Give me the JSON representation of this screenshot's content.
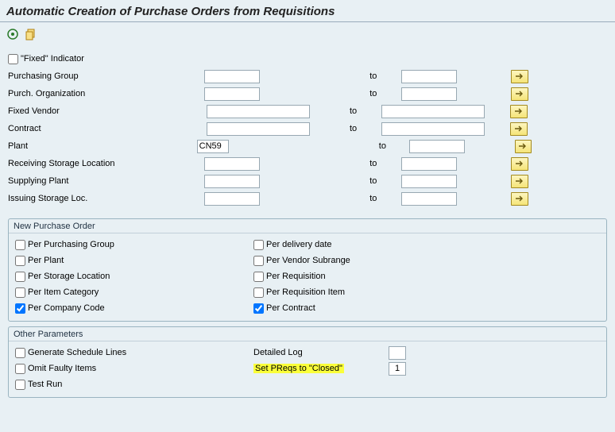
{
  "title": "Automatic Creation of Purchase Orders from Requisitions",
  "checkbox_fixed": "\"Fixed\" Indicator",
  "criteria": [
    {
      "label": "Purchasing Group",
      "from": "",
      "to_label": "to",
      "to": "",
      "kind": "short"
    },
    {
      "label": "Purch. Organization",
      "from": "",
      "to_label": "to",
      "to": "",
      "kind": "short"
    },
    {
      "label": "Fixed Vendor",
      "from": "",
      "to_label": "to",
      "to": "",
      "kind": "wide"
    },
    {
      "label": "Contract",
      "from": "",
      "to_label": "to",
      "to": "",
      "kind": "wide"
    },
    {
      "label": "Plant",
      "from": "CN59",
      "to_label": "to",
      "to": "",
      "kind": "xshort"
    },
    {
      "label": "Receiving Storage Location",
      "from": "",
      "to_label": "to",
      "to": "",
      "kind": "short"
    },
    {
      "label": "Supplying Plant",
      "from": "",
      "to_label": "to",
      "to": "",
      "kind": "short"
    },
    {
      "label": "Issuing Storage Loc.",
      "from": "",
      "to_label": "to",
      "to": "",
      "kind": "short"
    }
  ],
  "group_npo": {
    "title": "New Purchase Order",
    "left": [
      {
        "label": "Per Purchasing Group",
        "checked": false
      },
      {
        "label": "Per Plant",
        "checked": false
      },
      {
        "label": "Per Storage Location",
        "checked": false
      },
      {
        "label": "Per Item Category",
        "checked": false
      },
      {
        "label": "Per Company Code",
        "checked": true
      }
    ],
    "right": [
      {
        "label": "Per delivery date",
        "checked": false
      },
      {
        "label": "Per Vendor Subrange",
        "checked": false
      },
      {
        "label": "Per Requisition",
        "checked": false
      },
      {
        "label": "Per Requisition Item",
        "checked": false
      },
      {
        "label": "Per Contract",
        "checked": true
      }
    ]
  },
  "group_other": {
    "title": "Other Parameters",
    "left": [
      {
        "label": "Generate Schedule Lines",
        "checked": false
      },
      {
        "label": "Omit Faulty Items",
        "checked": false
      },
      {
        "label": "Test Run",
        "checked": false
      }
    ],
    "right_detailed": "Detailed Log",
    "right_closed_label": "Set PReqs to \"Closed\"",
    "right_closed_value": "1"
  }
}
